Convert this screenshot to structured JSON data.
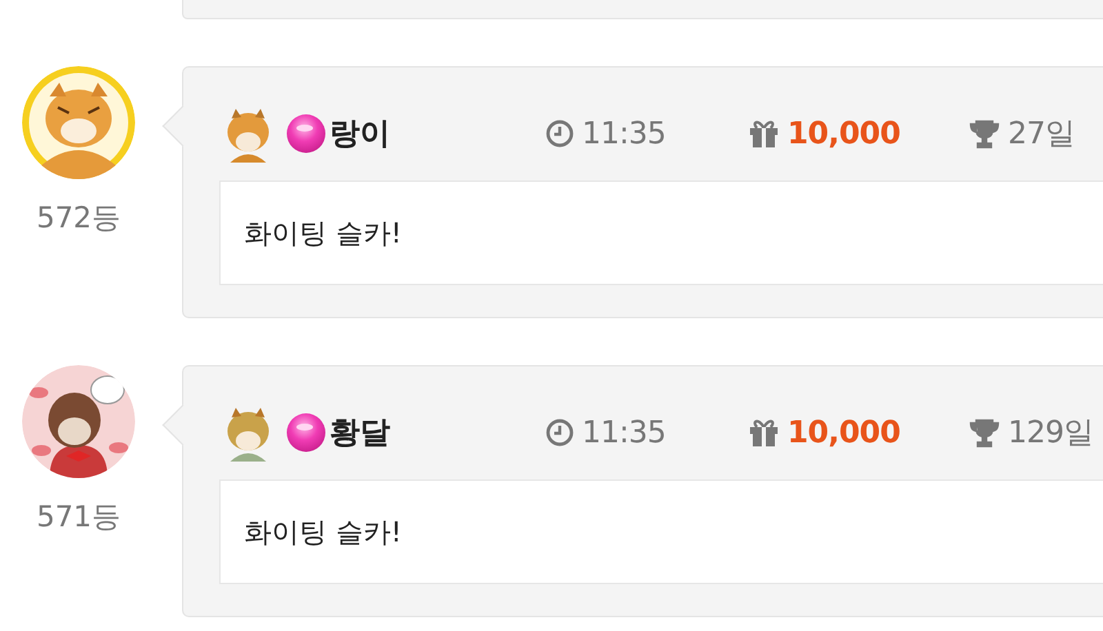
{
  "entries": [
    {
      "rank": "572등",
      "name": "랑이",
      "time": "11:35",
      "gift": "10,000",
      "days": "27일",
      "message": "화이팅 슬카!"
    },
    {
      "rank": "571등",
      "name": "황달",
      "time": "11:35",
      "gift": "10,000",
      "days": "129일",
      "message": "화이팅 슬카!"
    }
  ]
}
